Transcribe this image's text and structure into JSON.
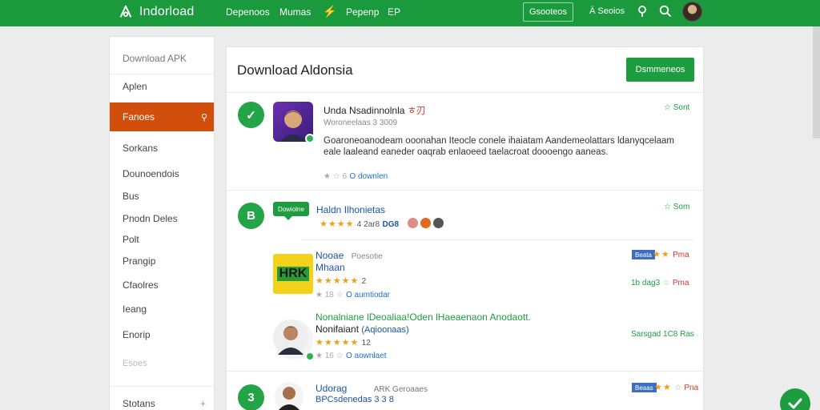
{
  "header": {
    "logo_text": "Indorload",
    "nav": [
      "Depenoos",
      "Mumas",
      "Pepenp",
      "EP"
    ],
    "bolt": "⚡",
    "button_label": "Gsooteos",
    "link_text": "Ä Seoios",
    "accent": "#1a9a3c"
  },
  "sidebar": {
    "header": "Download APK",
    "items": [
      "Aplen",
      "Fanoes",
      "Sorkans",
      "Dounoendois",
      "Bus",
      "Pnodn Deles",
      "Polt",
      "Prangip",
      "Cfaolres",
      "Ieang",
      "Enorip",
      "Esoes",
      "Stotans"
    ],
    "active_index": 1,
    "active_color": "#d24e0d"
  },
  "main": {
    "title": "Download Aldonsia",
    "button_label": "Dsmmeneos",
    "items": [
      {
        "badge": "✓",
        "title": "Unda Nsadinnolnla",
        "title_suffix": "ㅎ刃",
        "subtitle": "Woroneelaas  3 3009",
        "desc1": "Goaroneoanodeam ooonahan Iteocle conele ihaiatam Aandemeolattars ldanyqcelaam",
        "desc2": "eale laaleand eaneder oaqrab enlaoeed taelacroat doooengo aaneas.",
        "meta_left": "★ ☆ 6",
        "meta_link": "O downlen",
        "right": "Sont"
      },
      {
        "badge": "B",
        "bubble": "Dowiolne",
        "title": "Haldn Ilhonietas",
        "stars": "★★★★",
        "meta": "4 2ar8",
        "code": "DG8",
        "right": "Som"
      },
      {
        "title": "Nooae",
        "title_extra": "Poesotie",
        "title2": "Mhaan",
        "stars": "★★★★★",
        "stars_count": "2",
        "meta_left": "★ 18 ☆",
        "meta_link": "O aumtiodar",
        "tag": "Beata",
        "right_red": "Pma",
        "right2": "1b dag3",
        "right2_red": "Pma",
        "icon_text": "HRK"
      },
      {
        "title": "Nonalniane  lDeoaliaa!Oden lHaeaenaon Anodaott.",
        "title2": "Nonifaiant",
        "title2_paren": "(Aqioonaas)",
        "stars": "★★★★★",
        "stars_count": "12",
        "meta_left": "★ 16 ☆",
        "meta_link": "O aownlaet",
        "right": "Sarsgad 1C8 Ras"
      },
      {
        "badge": "3",
        "title": "Udorag",
        "title_extra": "ARK    Geroaaes",
        "subtitle": "BPCsdenedas  3 3 8",
        "tag": "Beaas",
        "right_red": "Pna"
      }
    ]
  }
}
